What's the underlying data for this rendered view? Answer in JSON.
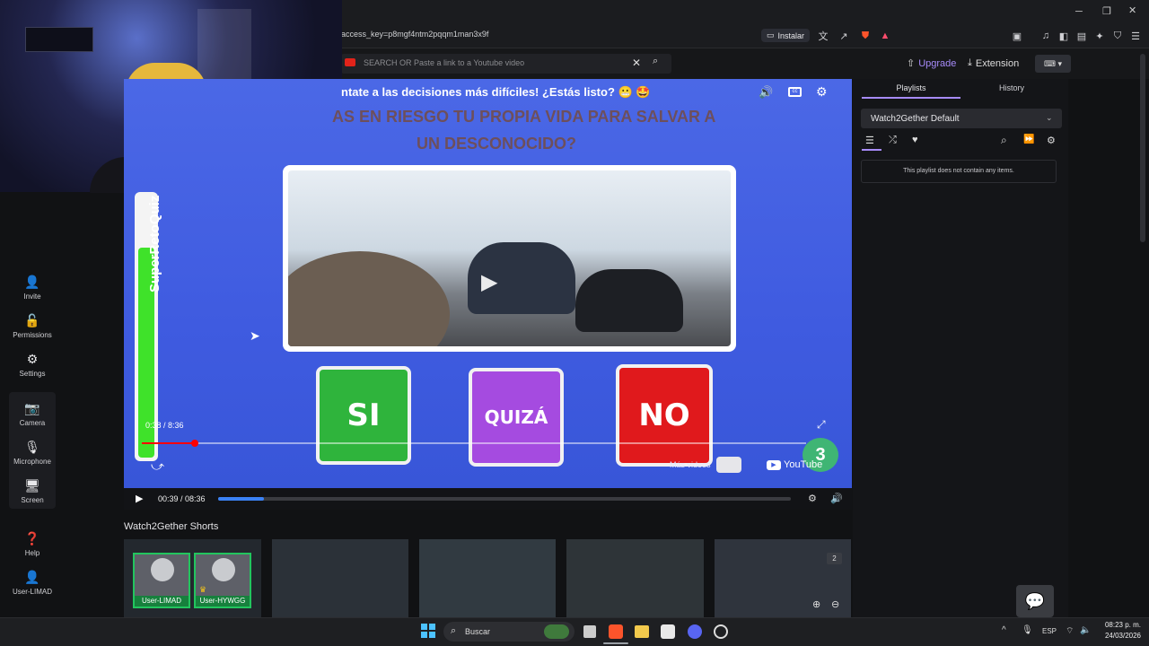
{
  "browser": {
    "url": "access_key=p8mgf4ntm2pqqm1man3x9f",
    "install_label": "Instalar"
  },
  "header": {
    "search_placeholder": "SEARCH OR Paste a link to a Youtube video",
    "upgrade_label": "Upgrade",
    "extension_label": "Extension"
  },
  "sidebar": {
    "items": [
      {
        "label": "Invite",
        "icon": "add-user-icon"
      },
      {
        "label": "Permissions",
        "icon": "unlock-icon"
      },
      {
        "label": "Settings",
        "icon": "gear-icon"
      },
      {
        "label": "Camera",
        "icon": "camera-icon"
      },
      {
        "label": "Microphone",
        "icon": "microphone-icon"
      },
      {
        "label": "Screen",
        "icon": "monitor-icon"
      },
      {
        "label": "Help",
        "icon": "help-icon"
      },
      {
        "label": "User-LIMAD",
        "icon": "user-icon"
      }
    ]
  },
  "video": {
    "title": "ntate a las decisiones más difíciles! ¿Estás listo? 😬 🤩",
    "question_line1": "AS EN RIESGO TU PROPIA VIDA PARA SALVAR A",
    "question_line2": "UN DESCONOCIDO?",
    "channel_tag": "SuperRetoQuiz",
    "btn_si": "SI",
    "btn_quiza": "QUIZÁ",
    "btn_no": "NO",
    "inner_time": "0:38 / 8:36",
    "countdown": "3",
    "more_videos": "Más videos",
    "youtube_label": "YouTube",
    "timer_fill": 0.8,
    "inner_progress": 0.08
  },
  "player_controls": {
    "time": "00:39 / 08:36",
    "progress": 0.08
  },
  "shorts": {
    "heading": "Watch2Gether Shorts",
    "badge": "2"
  },
  "users": [
    {
      "name": "User-LIMAD"
    },
    {
      "name": "User-HYWGG"
    }
  ],
  "playlist": {
    "tabs": [
      "Playlists",
      "History"
    ],
    "selected": "Watch2Gether Default",
    "empty_text": "This playlist does not contain any items."
  },
  "taskbar": {
    "search_label": "Buscar",
    "lang": "ESP",
    "time": "08:23 p. m.",
    "date": "24/03/2026"
  },
  "colors": {
    "accent_purple": "#a78bfa",
    "player_blue": "#4563e3",
    "si_green": "#2fb43c",
    "quiza_purple": "#a54be0",
    "no_red": "#e0191c",
    "progress_blue": "#3b82f6"
  }
}
